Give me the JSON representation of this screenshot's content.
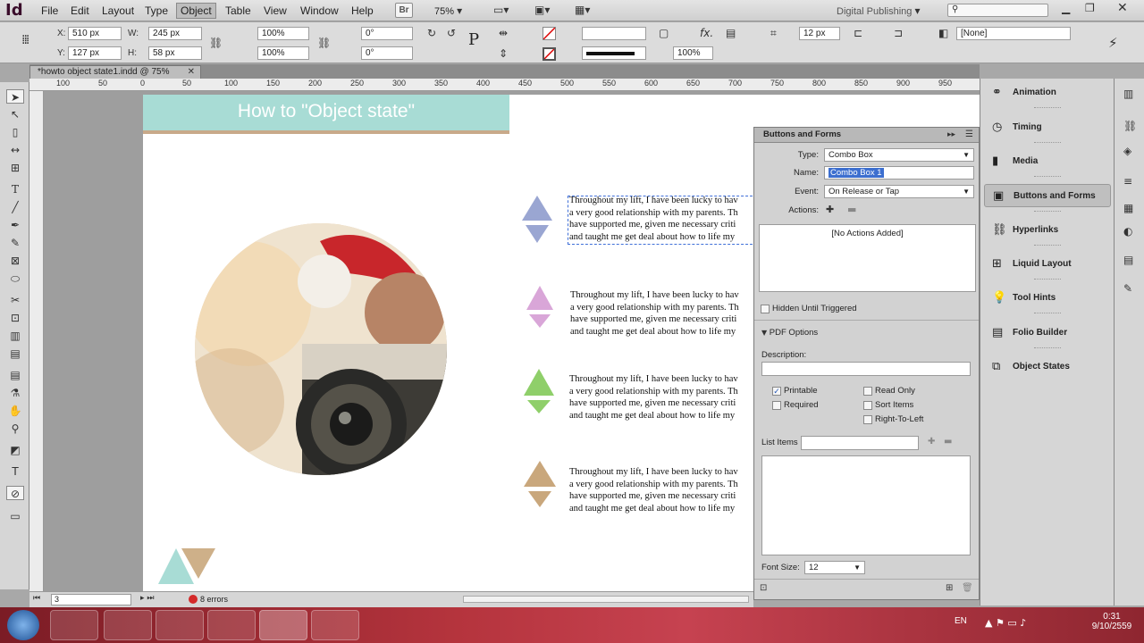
{
  "menubar": {
    "app_logo": "Id",
    "items": [
      "File",
      "Edit",
      "Layout",
      "Type",
      "Object",
      "Table",
      "View",
      "Window",
      "Help"
    ],
    "selected": "Object",
    "br_label": "Br",
    "zoom": "75%",
    "workspace": "Digital Publishing"
  },
  "control": {
    "x_label": "X:",
    "x_value": "510 px",
    "y_label": "Y:",
    "y_value": "127 px",
    "w_label": "W:",
    "w_value": "245 px",
    "h_label": "H:",
    "h_value": "58 px",
    "scale_x": "100%",
    "scale_y": "100%",
    "rotate": "0°",
    "shear": "0°",
    "stroke_weight": "12 px",
    "opacity": "100%",
    "style_none": "[None]"
  },
  "doc_tab": "*howto object state1.indd @ 75%",
  "ruler": [
    "100",
    "50",
    "0",
    "50",
    "100",
    "150",
    "200",
    "250",
    "300",
    "350",
    "400",
    "450",
    "500",
    "550",
    "600",
    "650",
    "700",
    "750",
    "800",
    "850",
    "900",
    "950"
  ],
  "page": {
    "title": "How to \"Object state\"",
    "paragraphs": [
      "Throughout my lift, I have been lucky to hav\na very good relationship with my parents. Th\nhave supported me, given me necessary criti\nand taught me get deal about how to life my",
      "Throughout my lift, I have been lucky to hav\na very good relationship with my parents. Th\nhave supported me, given me necessary criti\nand taught me get deal about how to life my",
      "Throughout my lift, I have been lucky to hav\na very good relationship with my parents. Th\nhave supported me, given me necessary criti\nand taught me get deal about how to life my",
      "Throughout my lift, I have been lucky to hav\na very good relationship with my parents. Th\nhave supported me, given me necessary criti\nand taught me get deal about how to life my"
    ],
    "triangle_colors": [
      "#9aa6d2",
      "#d9a6d8",
      "#8fcf6a",
      "#c9a77c"
    ]
  },
  "panel": {
    "title": "Buttons and Forms",
    "type_label": "Type:",
    "type_value": "Combo Box",
    "name_label": "Name:",
    "name_value": "Combo Box 1",
    "event_label": "Event:",
    "event_value": "On Release or Tap",
    "actions_label": "Actions:",
    "no_actions": "[No Actions Added]",
    "hidden_label": "Hidden Until Triggered",
    "pdf_options": "PDF Options",
    "description_label": "Description:",
    "printable": "Printable",
    "required": "Required",
    "read_only": "Read Only",
    "sort_items": "Sort Items",
    "rtl": "Right-To-Left",
    "list_items_label": "List Items",
    "font_size_label": "Font Size:",
    "font_size_value": "12"
  },
  "dock": [
    "Animation",
    "Timing",
    "Media",
    "Buttons and Forms",
    "Hyperlinks",
    "Liquid Layout",
    "Tool Hints",
    "Folio Builder",
    "Object States"
  ],
  "status": {
    "page": "3",
    "errors": "8 errors"
  },
  "taskbar": {
    "lang": "EN",
    "time": "0:31",
    "date": "9/10/2559"
  }
}
